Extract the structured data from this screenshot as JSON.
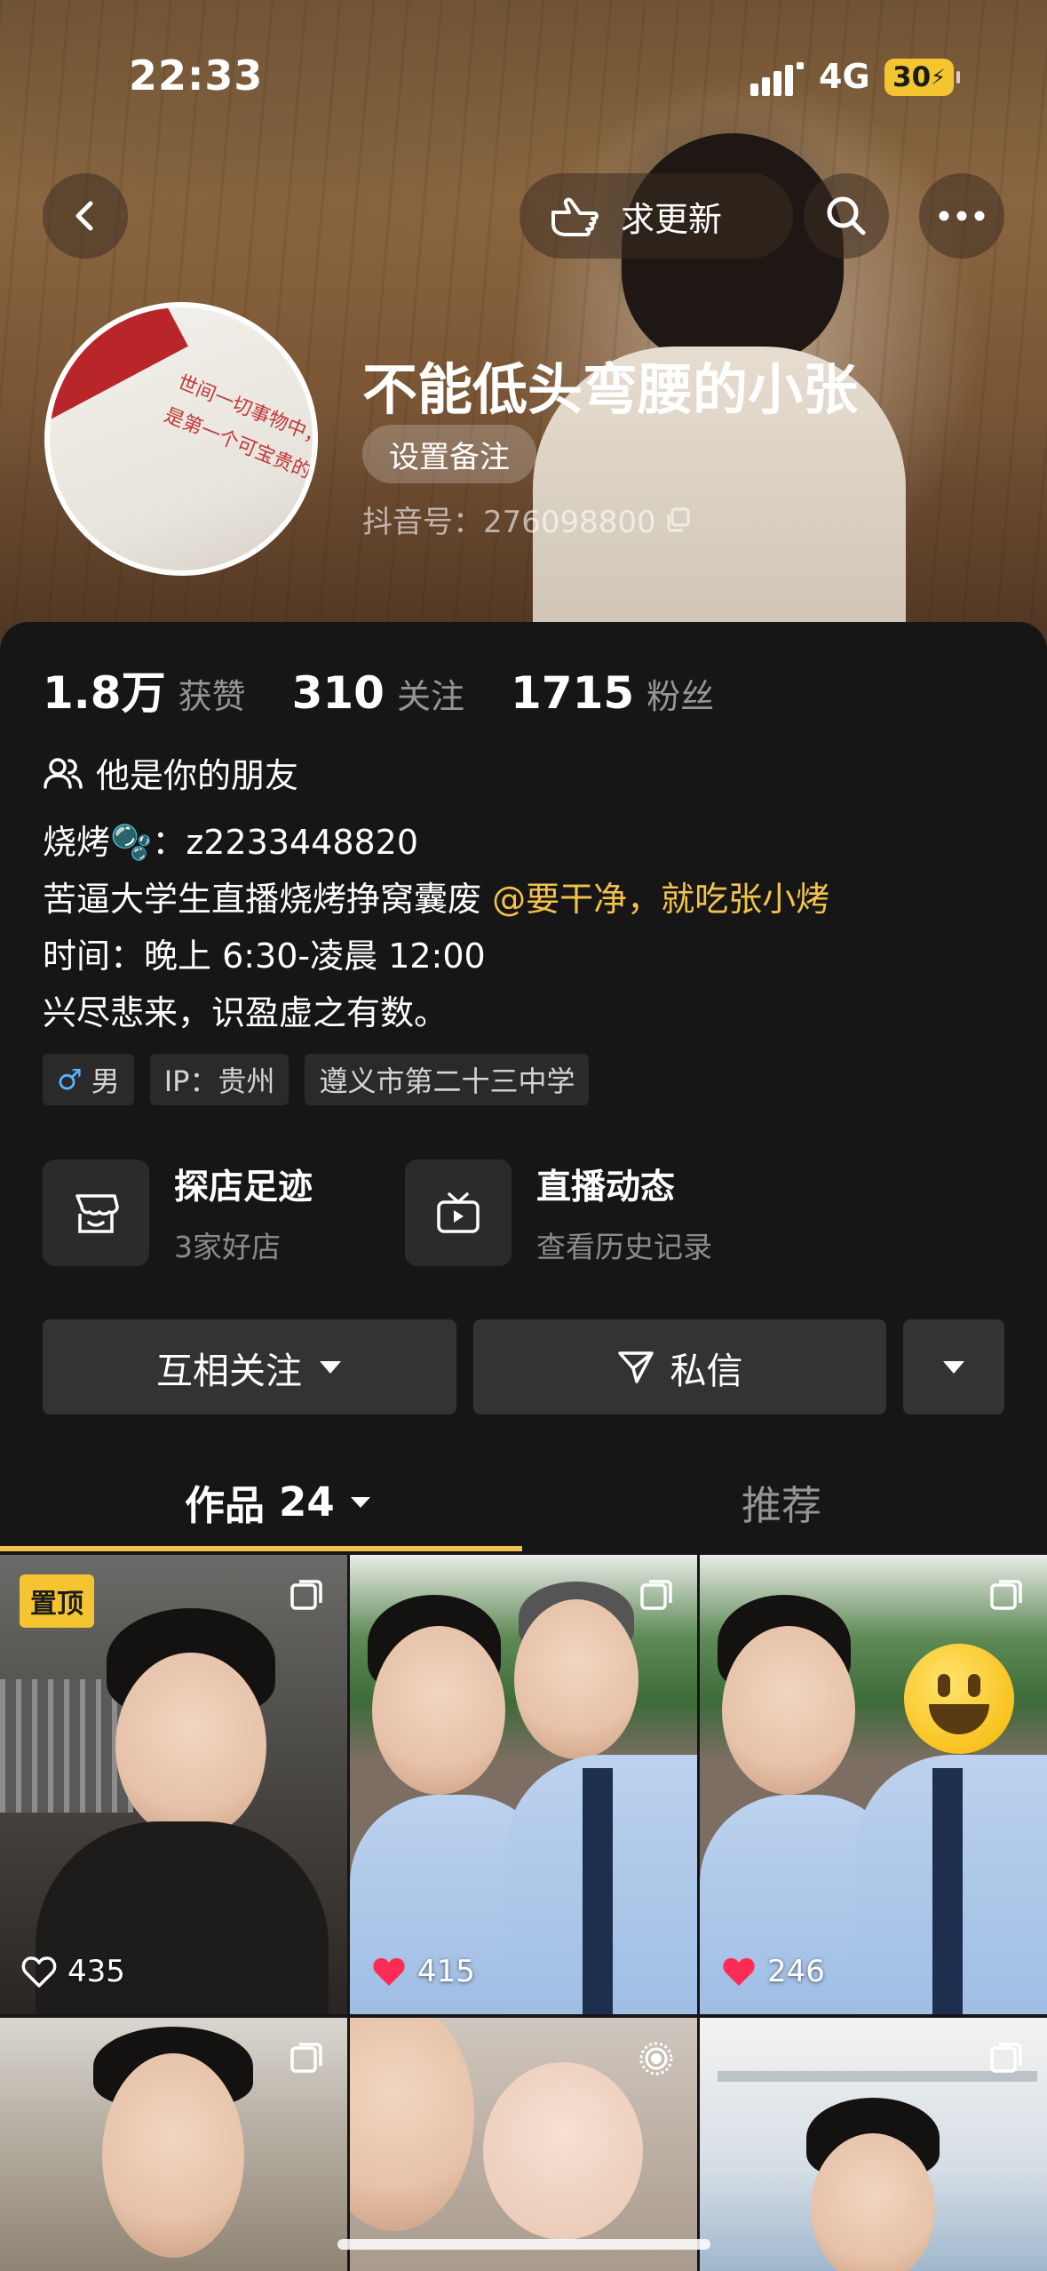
{
  "status_bar": {
    "time": "22:33",
    "network": "4G",
    "battery": "30"
  },
  "nav": {
    "request_update_label": "求更新"
  },
  "profile": {
    "name": "不能低头弯腰的小张",
    "remark_label": "设置备注",
    "douyin_id": "抖音号：276098800",
    "avatar_text": "世间一切事物中，人是第一个可宝贵的。"
  },
  "stats": [
    {
      "num": "1.8万",
      "label": "获赞"
    },
    {
      "num": "310",
      "label": "关注"
    },
    {
      "num": "1715",
      "label": "粉丝"
    }
  ],
  "friend_text": "他是你的朋友",
  "bio": {
    "line1": "烧烤🫧：z2233448820",
    "line2_text": "苦逼大学生直播烧烤挣窝囊废 ",
    "line2_mention": "@要干净，就吃张小烤",
    "line3": "时间：晚上 6:30-凌晨 12:00",
    "line4": "兴尽悲来，识盈虚之有数。"
  },
  "tags": {
    "gender": "男",
    "ip": "IP：贵州",
    "school": "遵义市第二十三中学"
  },
  "quick_links": [
    {
      "title": "探店足迹",
      "sub": "3家好店"
    },
    {
      "title": "直播动态",
      "sub": "查看历史记录"
    }
  ],
  "actions": {
    "follow_label": "互相关注",
    "message_label": "私信"
  },
  "tabs": {
    "works_label": "作品",
    "works_count": "24",
    "recommend_label": "推荐"
  },
  "videos": [
    {
      "pinned_label": "置顶",
      "likes": "435",
      "liked": false
    },
    {
      "likes": "415",
      "liked": true
    },
    {
      "likes": "246",
      "liked": true
    },
    {},
    {},
    {}
  ],
  "colors": {
    "accent": "#f3c24a",
    "like_red": "#fe2c55",
    "panel": "#161616"
  }
}
